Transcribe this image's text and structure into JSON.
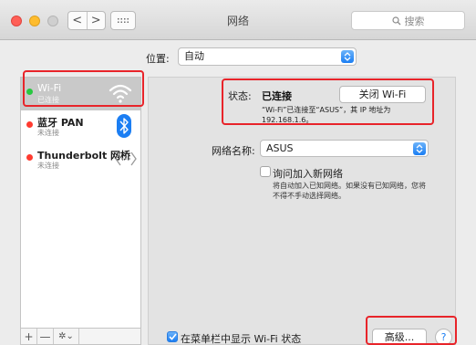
{
  "window": {
    "title": "网络",
    "search_placeholder": "搜索",
    "back_glyph": "<",
    "forward_glyph": ">"
  },
  "location": {
    "label": "位置:",
    "value": "自动"
  },
  "services": [
    {
      "name": "Wi-Fi",
      "status": "已连接",
      "dot_color": "#28c840",
      "icon": "wifi-icon"
    },
    {
      "name": "蓝牙 PAN",
      "status": "未连接",
      "dot_color": "#ff3b30",
      "icon": "bluetooth-icon"
    },
    {
      "name": "Thunderbolt 网桥",
      "status": "未连接",
      "dot_color": "#ff3b30",
      "icon": "thunderbolt-bridge-icon"
    }
  ],
  "sidebar_controls": {
    "add": "+",
    "remove": "—",
    "gear": "✲⌄"
  },
  "status": {
    "label": "状态:",
    "value": "已连接",
    "toggle_button": "关闭 Wi-Fi",
    "description": "“Wi-Fi”已连接至“ASUS”，其 IP 地址为 192.168.1.6。"
  },
  "network": {
    "label": "网络名称:",
    "value": "ASUS",
    "ask_label": "询问加入新网络",
    "ask_checked": false,
    "ask_description": "将自动加入已知网络。如果没有已知网络，您将不得不手动选择网络。"
  },
  "footer": {
    "show_in_menubar_label": "在菜单栏中显示 Wi-Fi 状态",
    "show_in_menubar_checked": true,
    "advanced_button": "高级...",
    "help_button": "?"
  },
  "colors": {
    "highlight": "#e8242a",
    "accent": "#1b7ef3",
    "connected": "#28c840",
    "disconnected": "#ff3b30"
  }
}
